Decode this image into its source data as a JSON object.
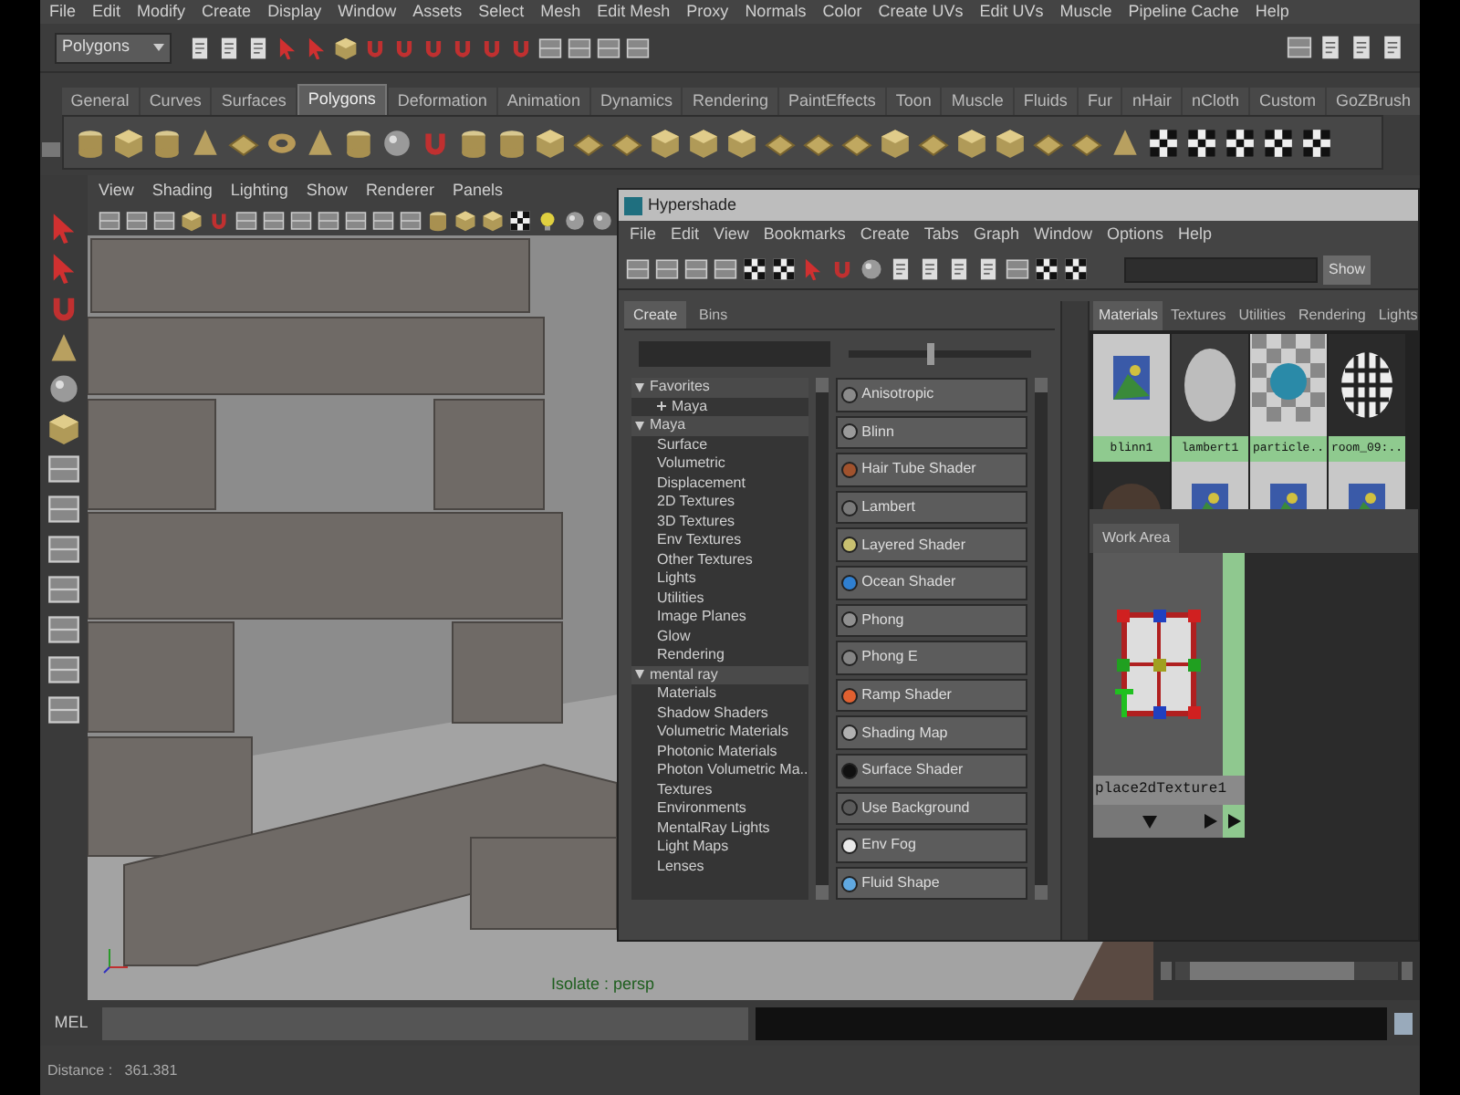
{
  "menu_bar": [
    "File",
    "Edit",
    "Modify",
    "Create",
    "Display",
    "Window",
    "Assets",
    "Select",
    "Mesh",
    "Edit Mesh",
    "Proxy",
    "Normals",
    "Color",
    "Create UVs",
    "Edit UVs",
    "Muscle",
    "Pipeline Cache",
    "Help"
  ],
  "status_line": {
    "menu_set": "Polygons"
  },
  "shelf_tabs": [
    {
      "label": "General",
      "selected": false
    },
    {
      "label": "Curves",
      "selected": false
    },
    {
      "label": "Surfaces",
      "selected": false
    },
    {
      "label": "Polygons",
      "selected": true
    },
    {
      "label": "Deformation",
      "selected": false
    },
    {
      "label": "Animation",
      "selected": false
    },
    {
      "label": "Dynamics",
      "selected": false
    },
    {
      "label": "Rendering",
      "selected": false
    },
    {
      "label": "PaintEffects",
      "selected": false
    },
    {
      "label": "Toon",
      "selected": false
    },
    {
      "label": "Muscle",
      "selected": false
    },
    {
      "label": "Fluids",
      "selected": false
    },
    {
      "label": "Fur",
      "selected": false
    },
    {
      "label": "nHair",
      "selected": false
    },
    {
      "label": "nCloth",
      "selected": false
    },
    {
      "label": "Custom",
      "selected": false
    },
    {
      "label": "GoZBrush",
      "selected": false
    }
  ],
  "viewport": {
    "menu": [
      "View",
      "Shading",
      "Lighting",
      "Show",
      "Renderer",
      "Panels"
    ],
    "camera_label": "Isolate : persp"
  },
  "hypershade": {
    "title": "Hypershade",
    "menu": [
      "File",
      "Edit",
      "View",
      "Bookmarks",
      "Create",
      "Tabs",
      "Graph",
      "Window",
      "Options",
      "Help"
    ],
    "show_button": "Show",
    "icon_size_slider": {
      "level": 0.45
    },
    "create_tabs": [
      {
        "label": "Create",
        "selected": true
      },
      {
        "label": "Bins",
        "selected": false
      }
    ],
    "tree": [
      {
        "label": "Favorites",
        "expanded": true,
        "children": [
          {
            "label": "Maya",
            "expanded": false
          }
        ]
      },
      {
        "label": "Maya",
        "expanded": true,
        "children": [
          {
            "label": "Surface"
          },
          {
            "label": "Volumetric"
          },
          {
            "label": "Displacement"
          },
          {
            "label": "2D Textures"
          },
          {
            "label": "3D Textures"
          },
          {
            "label": "Env Textures"
          },
          {
            "label": "Other Textures"
          },
          {
            "label": "Lights"
          },
          {
            "label": "Utilities"
          },
          {
            "label": "Image Planes"
          },
          {
            "label": "Glow"
          },
          {
            "label": "Rendering"
          }
        ]
      },
      {
        "label": "mental ray",
        "expanded": true,
        "children": [
          {
            "label": "Materials"
          },
          {
            "label": "Shadow Shaders"
          },
          {
            "label": "Volumetric Materials"
          },
          {
            "label": "Photonic Materials"
          },
          {
            "label": "Photon Volumetric Ma..."
          },
          {
            "label": "Textures"
          },
          {
            "label": "Environments"
          },
          {
            "label": "MentalRay Lights"
          },
          {
            "label": "Light Maps"
          },
          {
            "label": "Lenses"
          }
        ]
      }
    ],
    "shaders": [
      {
        "label": "Anisotropic",
        "color": "#8a8a8a"
      },
      {
        "label": "Blinn",
        "color": "#9a9a9a"
      },
      {
        "label": "Hair Tube Shader",
        "color": "#a0522d"
      },
      {
        "label": "Lambert",
        "color": "#7a7a7a"
      },
      {
        "label": "Layered Shader",
        "color": "#c8c070"
      },
      {
        "label": "Ocean Shader",
        "color": "#2f7fd0"
      },
      {
        "label": "Phong",
        "color": "#909090"
      },
      {
        "label": "Phong E",
        "color": "#858585"
      },
      {
        "label": "Ramp Shader",
        "color": "#e06030"
      },
      {
        "label": "Shading Map",
        "color": "#b0b0b0"
      },
      {
        "label": "Surface Shader",
        "color": "#101010"
      },
      {
        "label": "Use Background",
        "color": "#5a5a5a"
      },
      {
        "label": "Env Fog",
        "color": "#e8e8e8"
      },
      {
        "label": "Fluid Shape",
        "color": "#60a8e0"
      }
    ],
    "material_tabs": [
      {
        "label": "Materials",
        "selected": true
      },
      {
        "label": "Textures",
        "selected": false
      },
      {
        "label": "Utilities",
        "selected": false
      },
      {
        "label": "Rendering",
        "selected": false
      },
      {
        "label": "Lights",
        "selected": false
      }
    ],
    "swatches": [
      {
        "kind": "texture",
        "label": "blinn1"
      },
      {
        "kind": "sphere",
        "label": "lambert1"
      },
      {
        "kind": "checker",
        "label": "particle.."
      },
      {
        "kind": "checker_sphere",
        "label": "room_09:.."
      }
    ],
    "swatches_row2": [
      {
        "kind": "dark_sphere"
      },
      {
        "kind": "texture"
      },
      {
        "kind": "texture"
      },
      {
        "kind": "texture"
      }
    ],
    "work_area": {
      "tab": "Work Area",
      "node_label": "place2dTexture1"
    }
  },
  "command_line": {
    "label": "MEL"
  },
  "help_line": "Distance :   361.381"
}
